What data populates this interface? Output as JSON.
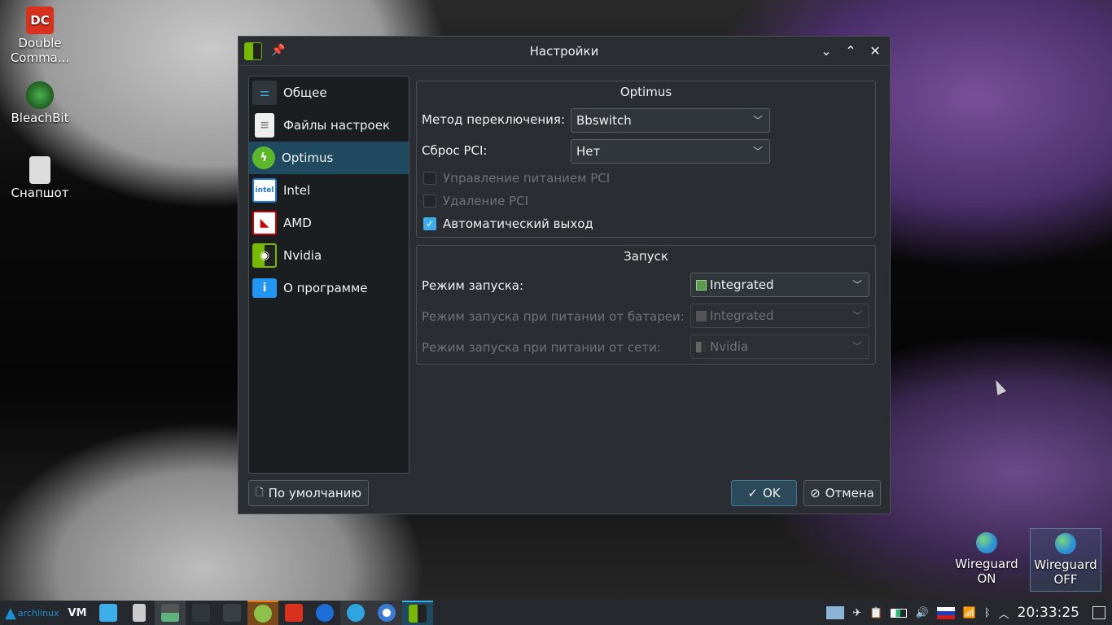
{
  "desktop": {
    "icons": [
      {
        "label": "Double Comma..."
      },
      {
        "label": "BleachBit"
      },
      {
        "label": "Снапшот"
      }
    ],
    "widgets": [
      {
        "label1": "Wireguard",
        "label2": "ON"
      },
      {
        "label1": "Wireguard",
        "label2": "OFF"
      }
    ]
  },
  "dialog": {
    "title": "Настройки",
    "sidebar": [
      {
        "label": "Общее",
        "icon": "sliders-icon"
      },
      {
        "label": "Файлы настроек",
        "icon": "document-icon"
      },
      {
        "label": "Optimus",
        "icon": "optimus-icon"
      },
      {
        "label": "Intel",
        "icon": "intel-icon"
      },
      {
        "label": "AMD",
        "icon": "amd-icon"
      },
      {
        "label": "Nvidia",
        "icon": "nvidia-icon"
      },
      {
        "label": "О программе",
        "icon": "info-icon"
      }
    ],
    "optimus": {
      "title": "Optimus",
      "switch_label": "Метод переключения:",
      "switch_value": "Bbswitch",
      "pci_reset_label": "Сброс PCI:",
      "pci_reset_value": "Нет",
      "pm_pci": "Управление питанием PCI",
      "remove_pci": "Удаление PCI",
      "auto_logout": "Автоматический выход"
    },
    "launch": {
      "title": "Запуск",
      "mode_label": "Режим запуска:",
      "mode_value": "Integrated",
      "battery_label": "Режим запуска при питании от батареи:",
      "battery_value": "Integrated",
      "ac_label": "Режим запуска при питании от сети:",
      "ac_value": "Nvidia"
    },
    "buttons": {
      "defaults": "По умолчанию",
      "ok": "OK",
      "cancel": "Отмена"
    }
  },
  "taskbar": {
    "launcher": "archlinux",
    "clock": "20:33:25"
  }
}
